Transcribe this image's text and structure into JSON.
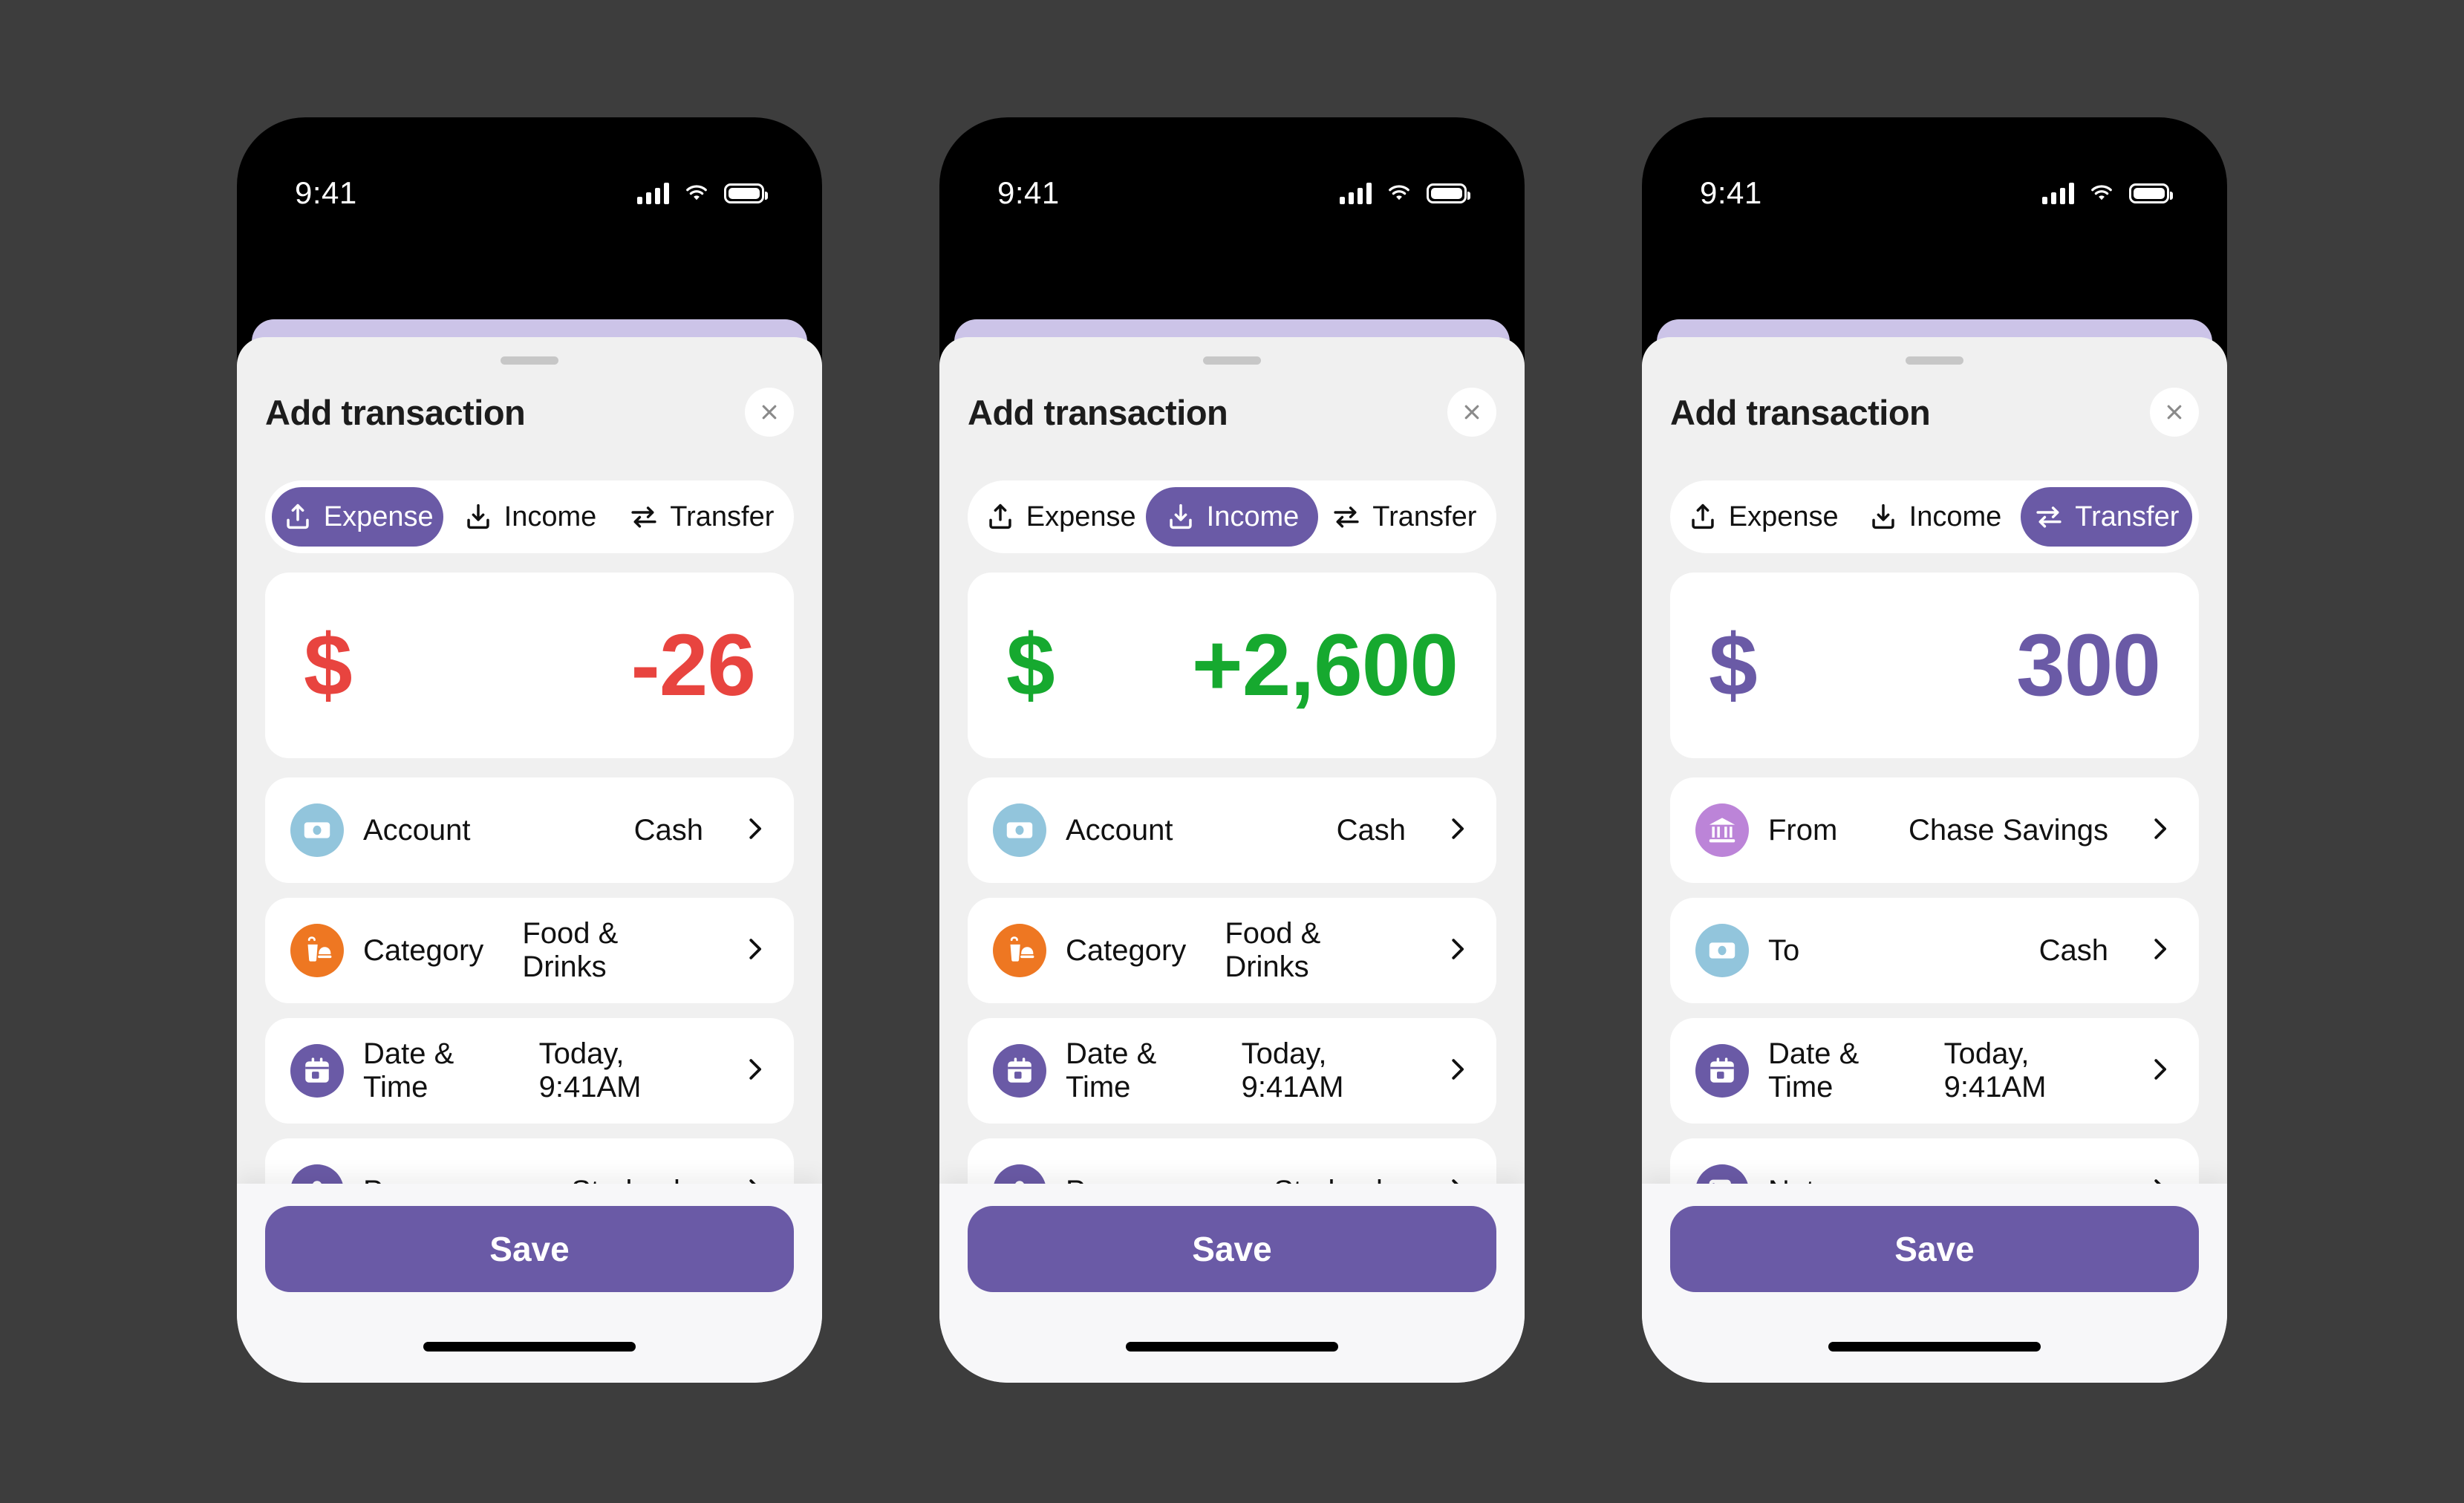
{
  "theme": {
    "accent": "#6A5AA6",
    "peek": "#CCC4E8",
    "sheet_bg": "#F0F0F0",
    "card_bg": "#FFFFFF",
    "page_bg": "#3D3D3D",
    "expense_color": "#E8443F",
    "income_color": "#16A92F",
    "transfer_color": "#6A5AA6",
    "icon_blue": "#92C5DC",
    "icon_orange": "#EE7722",
    "icon_purple": "#6A5AA6",
    "icon_orchid": "#BC84D8"
  },
  "status_bar": {
    "time": "9:41",
    "icons": [
      "cellular-signal-icon",
      "wifi-icon",
      "battery-icon"
    ]
  },
  "common": {
    "sheet_title": "Add transaction",
    "close_icon": "close-icon",
    "save_label": "Save",
    "chevron_icon": "chevron-right-icon",
    "grabber": "drag-handle"
  },
  "tabs": [
    {
      "id": "expense",
      "label": "Expense",
      "icon": "upload-arrow-icon"
    },
    {
      "id": "income",
      "label": "Income",
      "icon": "download-arrow-icon"
    },
    {
      "id": "transfer",
      "label": "Transfer",
      "icon": "transfer-arrows-icon"
    }
  ],
  "screens": [
    {
      "id": "expense",
      "active_tab": "expense",
      "amount": {
        "symbol": "$",
        "value": "-26",
        "color_class": "c-expense"
      },
      "rows": [
        {
          "label": "Account",
          "value": "Cash",
          "icon": "banknote-icon",
          "icon_color": "#92C5DC"
        },
        {
          "label": "Category",
          "value": "Food & Drinks",
          "icon": "food-drink-icon",
          "icon_color": "#EE7722"
        },
        {
          "label": "Date & Time",
          "value": "Today, 9:41AM",
          "icon": "calendar-icon",
          "icon_color": "#6A5AA6"
        },
        {
          "label": "Payee",
          "value": "Starbucks",
          "icon": "person-icon",
          "icon_color": "#6A5AA6"
        },
        {
          "label": "",
          "value": "",
          "icon": "notes-icon",
          "icon_color": "#6A5AA6"
        }
      ]
    },
    {
      "id": "income",
      "active_tab": "income",
      "amount": {
        "symbol": "$",
        "value": "+2,600",
        "color_class": "c-income"
      },
      "rows": [
        {
          "label": "Account",
          "value": "Cash",
          "icon": "banknote-icon",
          "icon_color": "#92C5DC"
        },
        {
          "label": "Category",
          "value": "Food & Drinks",
          "icon": "food-drink-icon",
          "icon_color": "#EE7722"
        },
        {
          "label": "Date & Time",
          "value": "Today, 9:41AM",
          "icon": "calendar-icon",
          "icon_color": "#6A5AA6"
        },
        {
          "label": "Payee",
          "value": "Starbucks",
          "icon": "person-icon",
          "icon_color": "#6A5AA6"
        },
        {
          "label": "",
          "value": "",
          "icon": "notes-icon",
          "icon_color": "#6A5AA6"
        }
      ]
    },
    {
      "id": "transfer",
      "active_tab": "transfer",
      "amount": {
        "symbol": "$",
        "value": "300",
        "color_class": "c-transfer"
      },
      "rows": [
        {
          "label": "From",
          "value": "Chase Savings",
          "icon": "bank-icon",
          "icon_color": "#BC84D8"
        },
        {
          "label": "To",
          "value": "Cash",
          "icon": "banknote-icon",
          "icon_color": "#92C5DC"
        },
        {
          "label": "Date & Time",
          "value": "Today, 9:41AM",
          "icon": "calendar-icon",
          "icon_color": "#6A5AA6"
        },
        {
          "label": "Notes",
          "value": "",
          "icon": "notes-icon",
          "icon_color": "#6A5AA6"
        }
      ]
    }
  ]
}
